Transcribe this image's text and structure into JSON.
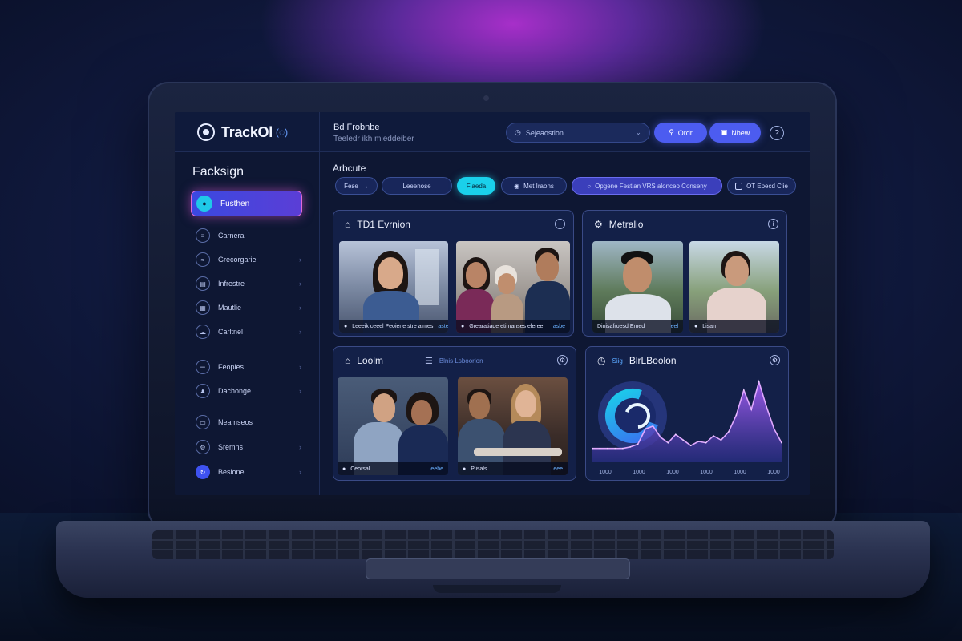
{
  "app": {
    "name": "TrackOl",
    "wave": "(◌)"
  },
  "header": {
    "title": "Bd Frobnbe",
    "subtitle": "Teeledr ikh mieddeiber",
    "search_placeholder": "Sejeaostion",
    "btn_primary": "Ordr",
    "btn_secondary": "Nbew",
    "help_icon": "?"
  },
  "sidebar": {
    "title": "Facksign",
    "active": {
      "label": "Fusthen"
    },
    "items": [
      {
        "label": "Carneral"
      },
      {
        "label": "Grecorgarie"
      },
      {
        "label": "Infrestre"
      },
      {
        "label": "Mautlie"
      },
      {
        "label": "Carltnel"
      },
      {
        "label": "Feopies"
      },
      {
        "label": "Dachonge"
      },
      {
        "label": "Neamseos"
      },
      {
        "label": "Sremns"
      },
      {
        "label": "Beslone"
      }
    ]
  },
  "main": {
    "section_title": "Arbcute",
    "chips": [
      {
        "label": "Fese"
      },
      {
        "label": "Leeenose"
      },
      {
        "label": "Flaeda"
      },
      {
        "label": "Met Iraons"
      },
      {
        "label": "Opgene Festian  VRS alonceo Conseny"
      },
      {
        "label": "OT Epecd Clie"
      }
    ],
    "cards": {
      "top_left": {
        "title": "TD1 Evrnion",
        "tiles": [
          {
            "caption": "Leeeik ceeel Peoiene stre aimes",
            "tag": "aste"
          },
          {
            "caption": "Grearatiade etimanses eleree",
            "tag": "asbe"
          }
        ]
      },
      "top_right": {
        "title": "Metralio",
        "tiles": [
          {
            "caption": "Dinisafroesd Emed",
            "tag": "eel"
          },
          {
            "caption": "Lisan",
            "tag": ""
          }
        ]
      },
      "bottom_left": {
        "title": "Loolm",
        "subtitle": "Blnis Lsboorlon",
        "tiles": [
          {
            "caption": "Ceorsal",
            "tag": "eebe"
          },
          {
            "caption": "Plisals",
            "tag": "eee"
          }
        ]
      },
      "bottom_right": {
        "title": "BlrLBoolon",
        "legend": "Siig",
        "x_ticks": [
          "1000",
          "1000",
          "1000",
          "1000",
          "1000",
          "1000"
        ]
      }
    }
  },
  "colors": {
    "accent": "#4c5cf0",
    "cyan": "#1ad0ea",
    "magenta": "#e06ad8",
    "panel": "#132048"
  },
  "chart_data": {
    "type": "area",
    "title": "BlrLBoolon",
    "xlabel": "",
    "ylabel": "",
    "x": [
      0,
      1,
      2,
      3,
      4,
      5,
      6,
      7,
      8,
      9,
      10,
      11,
      12,
      13,
      14,
      15,
      16,
      17,
      18,
      19,
      20,
      21,
      22,
      23,
      24,
      25
    ],
    "values": [
      10,
      10,
      10,
      10,
      10,
      11,
      13,
      24,
      26,
      18,
      14,
      20,
      16,
      12,
      15,
      14,
      19,
      16,
      22,
      34,
      52,
      38,
      58,
      40,
      24,
      14
    ],
    "ylim": [
      0,
      60
    ],
    "x_tick_labels": [
      "1000",
      "1000",
      "1000",
      "1000",
      "1000",
      "1000"
    ],
    "gauge": {
      "value": 0.75
    }
  }
}
